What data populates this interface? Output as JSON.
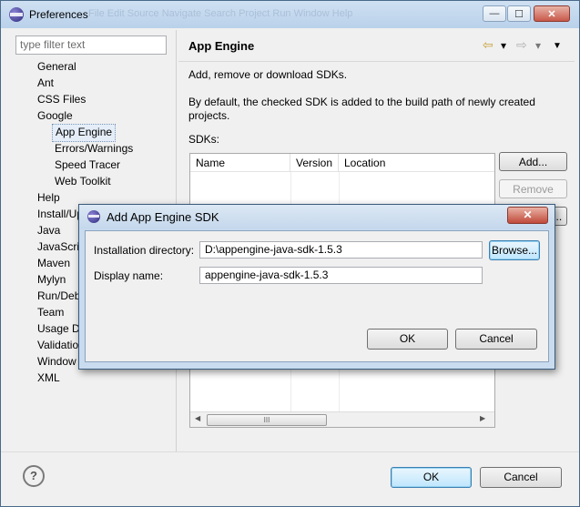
{
  "window": {
    "title": "Preferences",
    "ghost_menu": "File   Edit   Source   Navigate   Search   Project   Run   Window   Help",
    "minimize": "—",
    "maximize": "☐",
    "close": "✕"
  },
  "sidebar": {
    "filter_placeholder": "type filter text",
    "items": [
      {
        "label": "General"
      },
      {
        "label": "Ant"
      },
      {
        "label": "CSS Files"
      },
      {
        "label": "Google"
      },
      {
        "label": "App Engine",
        "selected": true
      },
      {
        "label": "Errors/Warnings"
      },
      {
        "label": "Speed Tracer"
      },
      {
        "label": "Web Toolkit"
      },
      {
        "label": "Help"
      },
      {
        "label": "Install/Update"
      },
      {
        "label": "Java"
      },
      {
        "label": "JavaScript"
      },
      {
        "label": "Maven"
      },
      {
        "label": "Mylyn"
      },
      {
        "label": "Run/Debug"
      },
      {
        "label": "Team"
      },
      {
        "label": "Usage Data"
      },
      {
        "label": "Validation"
      },
      {
        "label": "Window"
      },
      {
        "label": "XML"
      }
    ]
  },
  "main": {
    "title": "App Engine",
    "nav": {
      "back": "⇦",
      "forward": "⇨",
      "dropdown": "▾",
      "menu": "▼"
    },
    "description1": "Add, remove or download SDKs.",
    "description2_line1": "By default, the checked SDK is added to the build path of newly created",
    "description2_line2": "projects.",
    "sdks_label": "SDKs:",
    "table": {
      "columns": [
        "Name",
        "Version",
        "Location"
      ],
      "rows": []
    },
    "scroll_thumb": "III",
    "buttons": {
      "add": "Add...",
      "remove": "Remove",
      "download": "Download..."
    }
  },
  "footer": {
    "help": "?",
    "ok": "OK",
    "cancel": "Cancel"
  },
  "dialog": {
    "title": "Add App Engine SDK",
    "close": "✕",
    "install_dir_label": "Installation directory:",
    "install_dir_value": "D:\\appengine-java-sdk-1.5.3",
    "browse": "Browse...",
    "display_name_label": "Display name:",
    "display_name_value": "appengine-java-sdk-1.5.3",
    "ok": "OK",
    "cancel": "Cancel"
  },
  "colors": {
    "titlebar": "#b9d1ea",
    "default_button": "#bee6fd",
    "selection": "#e5eef8"
  }
}
